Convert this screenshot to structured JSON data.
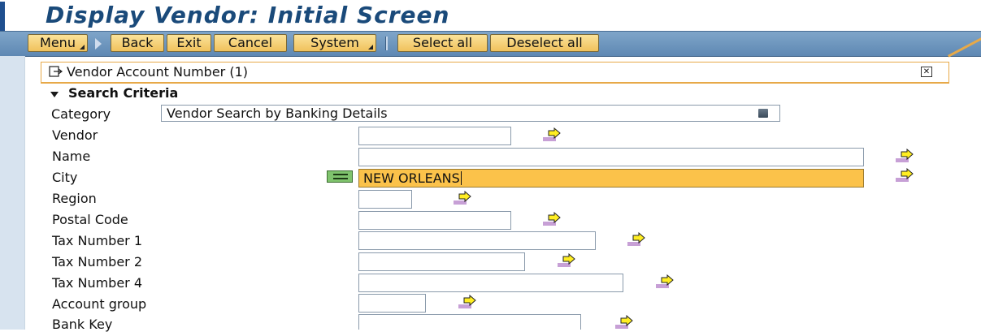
{
  "window": {
    "title": "Display Vendor: Initial Screen"
  },
  "toolbar": {
    "buttons": [
      {
        "label": "Menu",
        "dropdown": true
      },
      {
        "label": "Back"
      },
      {
        "label": "Exit"
      },
      {
        "label": "Cancel"
      },
      {
        "label": "System",
        "dropdown": true
      },
      {
        "label": "Select all"
      },
      {
        "label": "Deselect all"
      }
    ]
  },
  "panel": {
    "title": "Vendor Account Number (1)",
    "close_icon": "close-icon",
    "section": "Search Criteria"
  },
  "category": {
    "label": "Category",
    "value": "Vendor Search by Banking Details",
    "dropdown_icon": "list-icon"
  },
  "fields": [
    {
      "label": "Vendor",
      "value": ""
    },
    {
      "label": "Name",
      "value": ""
    },
    {
      "label": "City",
      "value": "NEW ORLEANS",
      "operator": "=",
      "focused": true
    },
    {
      "label": "Region",
      "value": ""
    },
    {
      "label": "Postal Code",
      "value": ""
    },
    {
      "label": "Tax Number 1",
      "value": ""
    },
    {
      "label": "Tax Number 2",
      "value": ""
    },
    {
      "label": "Tax Number 4",
      "value": ""
    },
    {
      "label": "Account group",
      "value": ""
    },
    {
      "label": "Bank Key",
      "value": ""
    }
  ],
  "multiple_selection_icon": "multiple-selection-arrow-icon",
  "colors": {
    "toolbar": "#6f98c0",
    "button": "#f7d27c",
    "focused_field": "#fbc24a",
    "panel_accent": "#e7a948",
    "title": "#1a4a7a",
    "operator": "#7fc36d"
  }
}
